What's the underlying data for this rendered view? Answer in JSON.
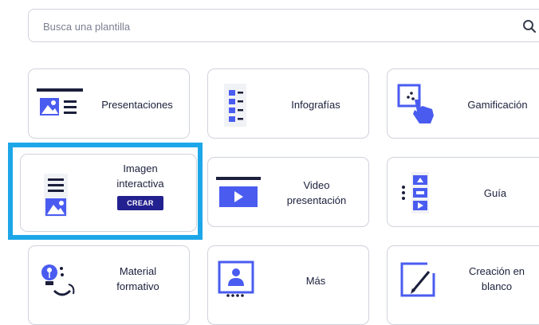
{
  "search": {
    "placeholder": "Busca una plantilla",
    "icon": "search-icon"
  },
  "templates": [
    {
      "label": "Presentaciones",
      "icon": "presentation-icon"
    },
    {
      "label": "Infografías",
      "icon": "infographic-icon"
    },
    {
      "label": "Gamificación",
      "icon": "gamification-icon"
    },
    {
      "label_line1": "Imagen",
      "label_line2": "interactiva",
      "icon": "interactive-image-icon",
      "action": "CREAR",
      "selected": true
    },
    {
      "label_line1": "Video",
      "label_line2": "presentación",
      "icon": "video-presentation-icon"
    },
    {
      "label": "Guía",
      "icon": "guide-icon"
    },
    {
      "label_line1": "Material",
      "label_line2": "formativo",
      "icon": "training-material-icon"
    },
    {
      "label": "Más",
      "icon": "more-icon"
    },
    {
      "label_line1": "Creación en",
      "label_line2": "blanco",
      "icon": "blank-creation-icon"
    }
  ],
  "colors": {
    "navy": "#1b1f3b",
    "accent": "#4a5cf0",
    "button": "#23208f",
    "highlight": "#1ea7e8"
  }
}
